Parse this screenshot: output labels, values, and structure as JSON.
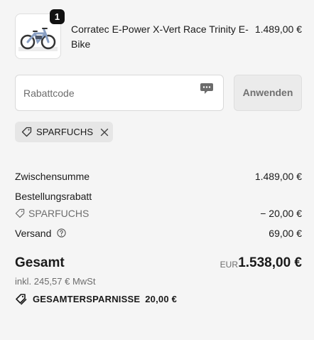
{
  "product": {
    "quantity": "1",
    "title": "Corratec E-Power X-Vert Race Trinity E-Bike",
    "price": "1.489,00 €",
    "image_icon": "e-bike-image"
  },
  "discount": {
    "placeholder": "Rabattcode",
    "apply_label": "Anwenden",
    "applied_code": "SPARFUCHS"
  },
  "summary": {
    "subtotal_label": "Zwischensumme",
    "subtotal_value": "1.489,00 €",
    "order_discount_label": "Bestellungsrabatt",
    "order_discount_code": "SPARFUCHS",
    "order_discount_value": "− 20,00 €",
    "shipping_label": "Versand",
    "shipping_value": "69,00 €",
    "total_label": "Gesamt",
    "total_currency": "EUR",
    "total_value": "1.538,00 €",
    "tax_line": "inkl. 245,57 € MwSt",
    "savings_label": "GESAMTERSPARNISSE",
    "savings_value": "20,00 €"
  }
}
